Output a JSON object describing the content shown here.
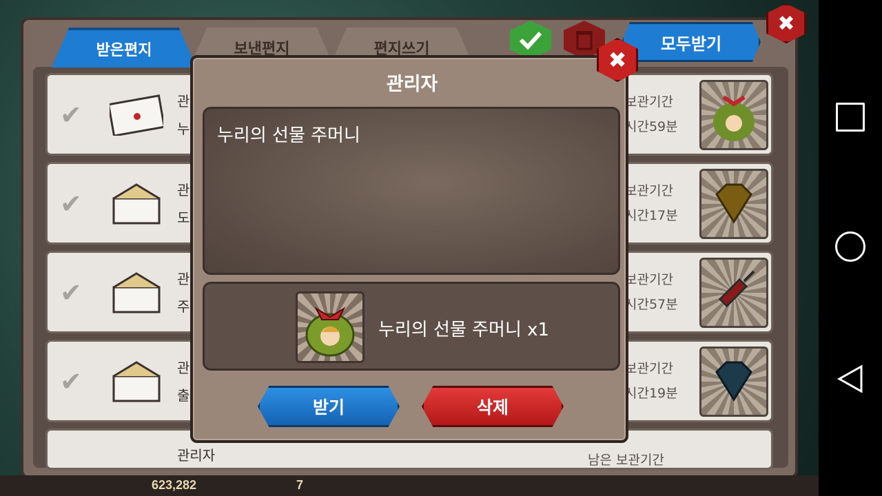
{
  "tabs": {
    "received": "받은편지",
    "sent": "보낸편지",
    "write": "편지쓰기"
  },
  "receive_all_label": "모두받기",
  "mails": [
    {
      "title": "관리자",
      "subtitle": "누",
      "expire_label": "보관기간",
      "expire_time": "시간59분",
      "icon": "gift-bag-icon"
    },
    {
      "title": "관",
      "subtitle": "도",
      "expire_label": "보관기간",
      "expire_time": "시간17분",
      "icon": "gold-diamond-icon"
    },
    {
      "title": "관",
      "subtitle": "주",
      "expire_label": "보관기간",
      "expire_time": "시간57분",
      "icon": "syringe-icon"
    },
    {
      "title": "관",
      "subtitle": "출",
      "expire_label": "보관기간",
      "expire_time": "시간19분",
      "icon": "blue-diamond-icon"
    },
    {
      "title": "관리자",
      "subtitle": "",
      "expire_label": "남은 보관기간",
      "expire_time": "",
      "icon": "crown-icon"
    }
  ],
  "dialog": {
    "title": "관리자",
    "message": "누리의 선물 주머니",
    "reward_text": "누리의 선물 주머니 x1",
    "receive_label": "받기",
    "delete_label": "삭제"
  },
  "currency": {
    "gold": "623,282",
    "gems": "7"
  },
  "colors": {
    "accent_blue": "#1e7dd2",
    "delete_red": "#c72222",
    "panel_brown": "#7b6a61"
  }
}
